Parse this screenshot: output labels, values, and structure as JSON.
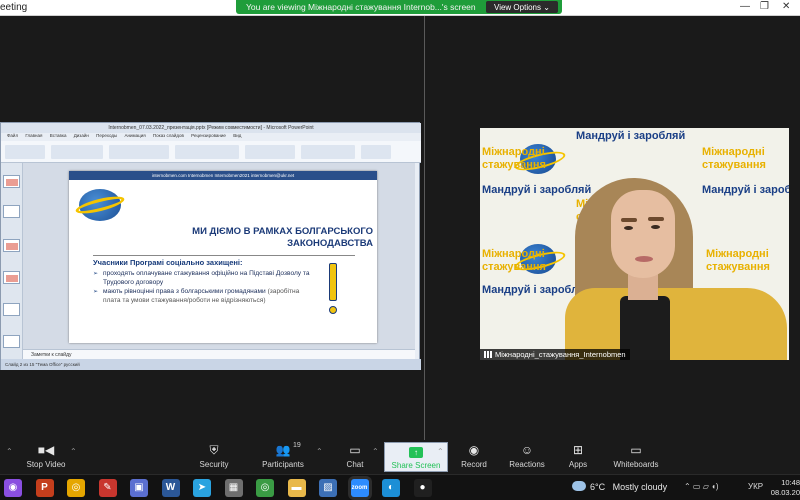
{
  "titlebar": {
    "window_title": "eeting",
    "controls": [
      "—",
      "❐",
      "✕"
    ]
  },
  "banner": {
    "text": "You are viewing Міжнародні стажування Internob...'s screen",
    "view_options": "View Options ⌄"
  },
  "powerpoint": {
    "window_title": "Internobmen_07.03.2022_презентація.pptx [Режим совместимости] - Microsoft PowerPoint",
    "tabs": [
      "Файл",
      "Главная",
      "Вставка",
      "Дизайн",
      "Переходы",
      "Анимация",
      "Показ слайдов",
      "Рецензирование",
      "Вид"
    ],
    "notes": "Заметки к слайду",
    "status": "Слайд 2 из 15   \"Тема Office\"   русский"
  },
  "slide": {
    "top_bar": "internobmen.com     Internobmen     Internobmen2021     internobmen@ukr.net",
    "heading": "МИ ДІЄМО В РАМКАХ БОЛГАРСЬКОГО ЗАКОНОДАВСТВА",
    "lead": "Учасники Програмі соціально захищені:",
    "bullet1": "проходять оплачуване стажування офіційно на Підставі Дозволу та  Трудового договору",
    "bullet2a": "мають рівноцінні права з  болгарськими громадянами",
    "bullet2b": "(заробітна плата та умови стажування/роботи не відрізняються)"
  },
  "video": {
    "name": "Міжнародні_стажування_Internobmen",
    "bg_travel": "Мандруй і заробляй",
    "bg_intern_1": "Міжнародні",
    "bg_intern_2": "стажування"
  },
  "toolbar": {
    "stop_video": "Stop Video",
    "security": "Security",
    "participants": "Participants",
    "participants_count": "19",
    "chat": "Chat",
    "share_screen": "Share Screen",
    "record": "Record",
    "reactions": "Reactions",
    "apps": "Apps",
    "whiteboards": "Whiteboards"
  },
  "taskbar": {
    "apps": [
      {
        "icon": "zoom-app-icon",
        "glyph": "◉",
        "color": "#8a4fe0"
      },
      {
        "icon": "powerpoint-icon",
        "glyph": "P",
        "color": "#c43e1c"
      },
      {
        "icon": "chrome-icon",
        "glyph": "◎",
        "color": "#e5a600"
      },
      {
        "icon": "paint-icon",
        "glyph": "✎",
        "color": "#c8362e"
      },
      {
        "icon": "storage-icon",
        "glyph": "▣",
        "color": "#5b6fd0"
      },
      {
        "icon": "word-icon",
        "glyph": "W",
        "color": "#2b5797"
      },
      {
        "icon": "telegram-icon",
        "glyph": "➤",
        "color": "#2aa3e0"
      },
      {
        "icon": "calculator-icon",
        "glyph": "▦",
        "color": "#6e6e6e"
      },
      {
        "icon": "chrome-2-icon",
        "glyph": "◎",
        "color": "#3a9b44"
      },
      {
        "icon": "folder-icon",
        "glyph": "▬",
        "color": "#e8b84a"
      },
      {
        "icon": "image-viewer-icon",
        "glyph": "▨",
        "color": "#3c6fb5"
      },
      {
        "icon": "zoom-meeting-icon",
        "glyph": "zoom",
        "color": "#2d8cff"
      },
      {
        "icon": "edge-icon",
        "glyph": "◐",
        "color": "#1c8fd6"
      },
      {
        "icon": "app-circle-icon",
        "glyph": "●",
        "color": "#202020"
      }
    ],
    "weather_temp": "6°C",
    "weather_text": "Mostly cloudy",
    "language": "УКР",
    "time": "10:48",
    "date": "08.03.20"
  }
}
